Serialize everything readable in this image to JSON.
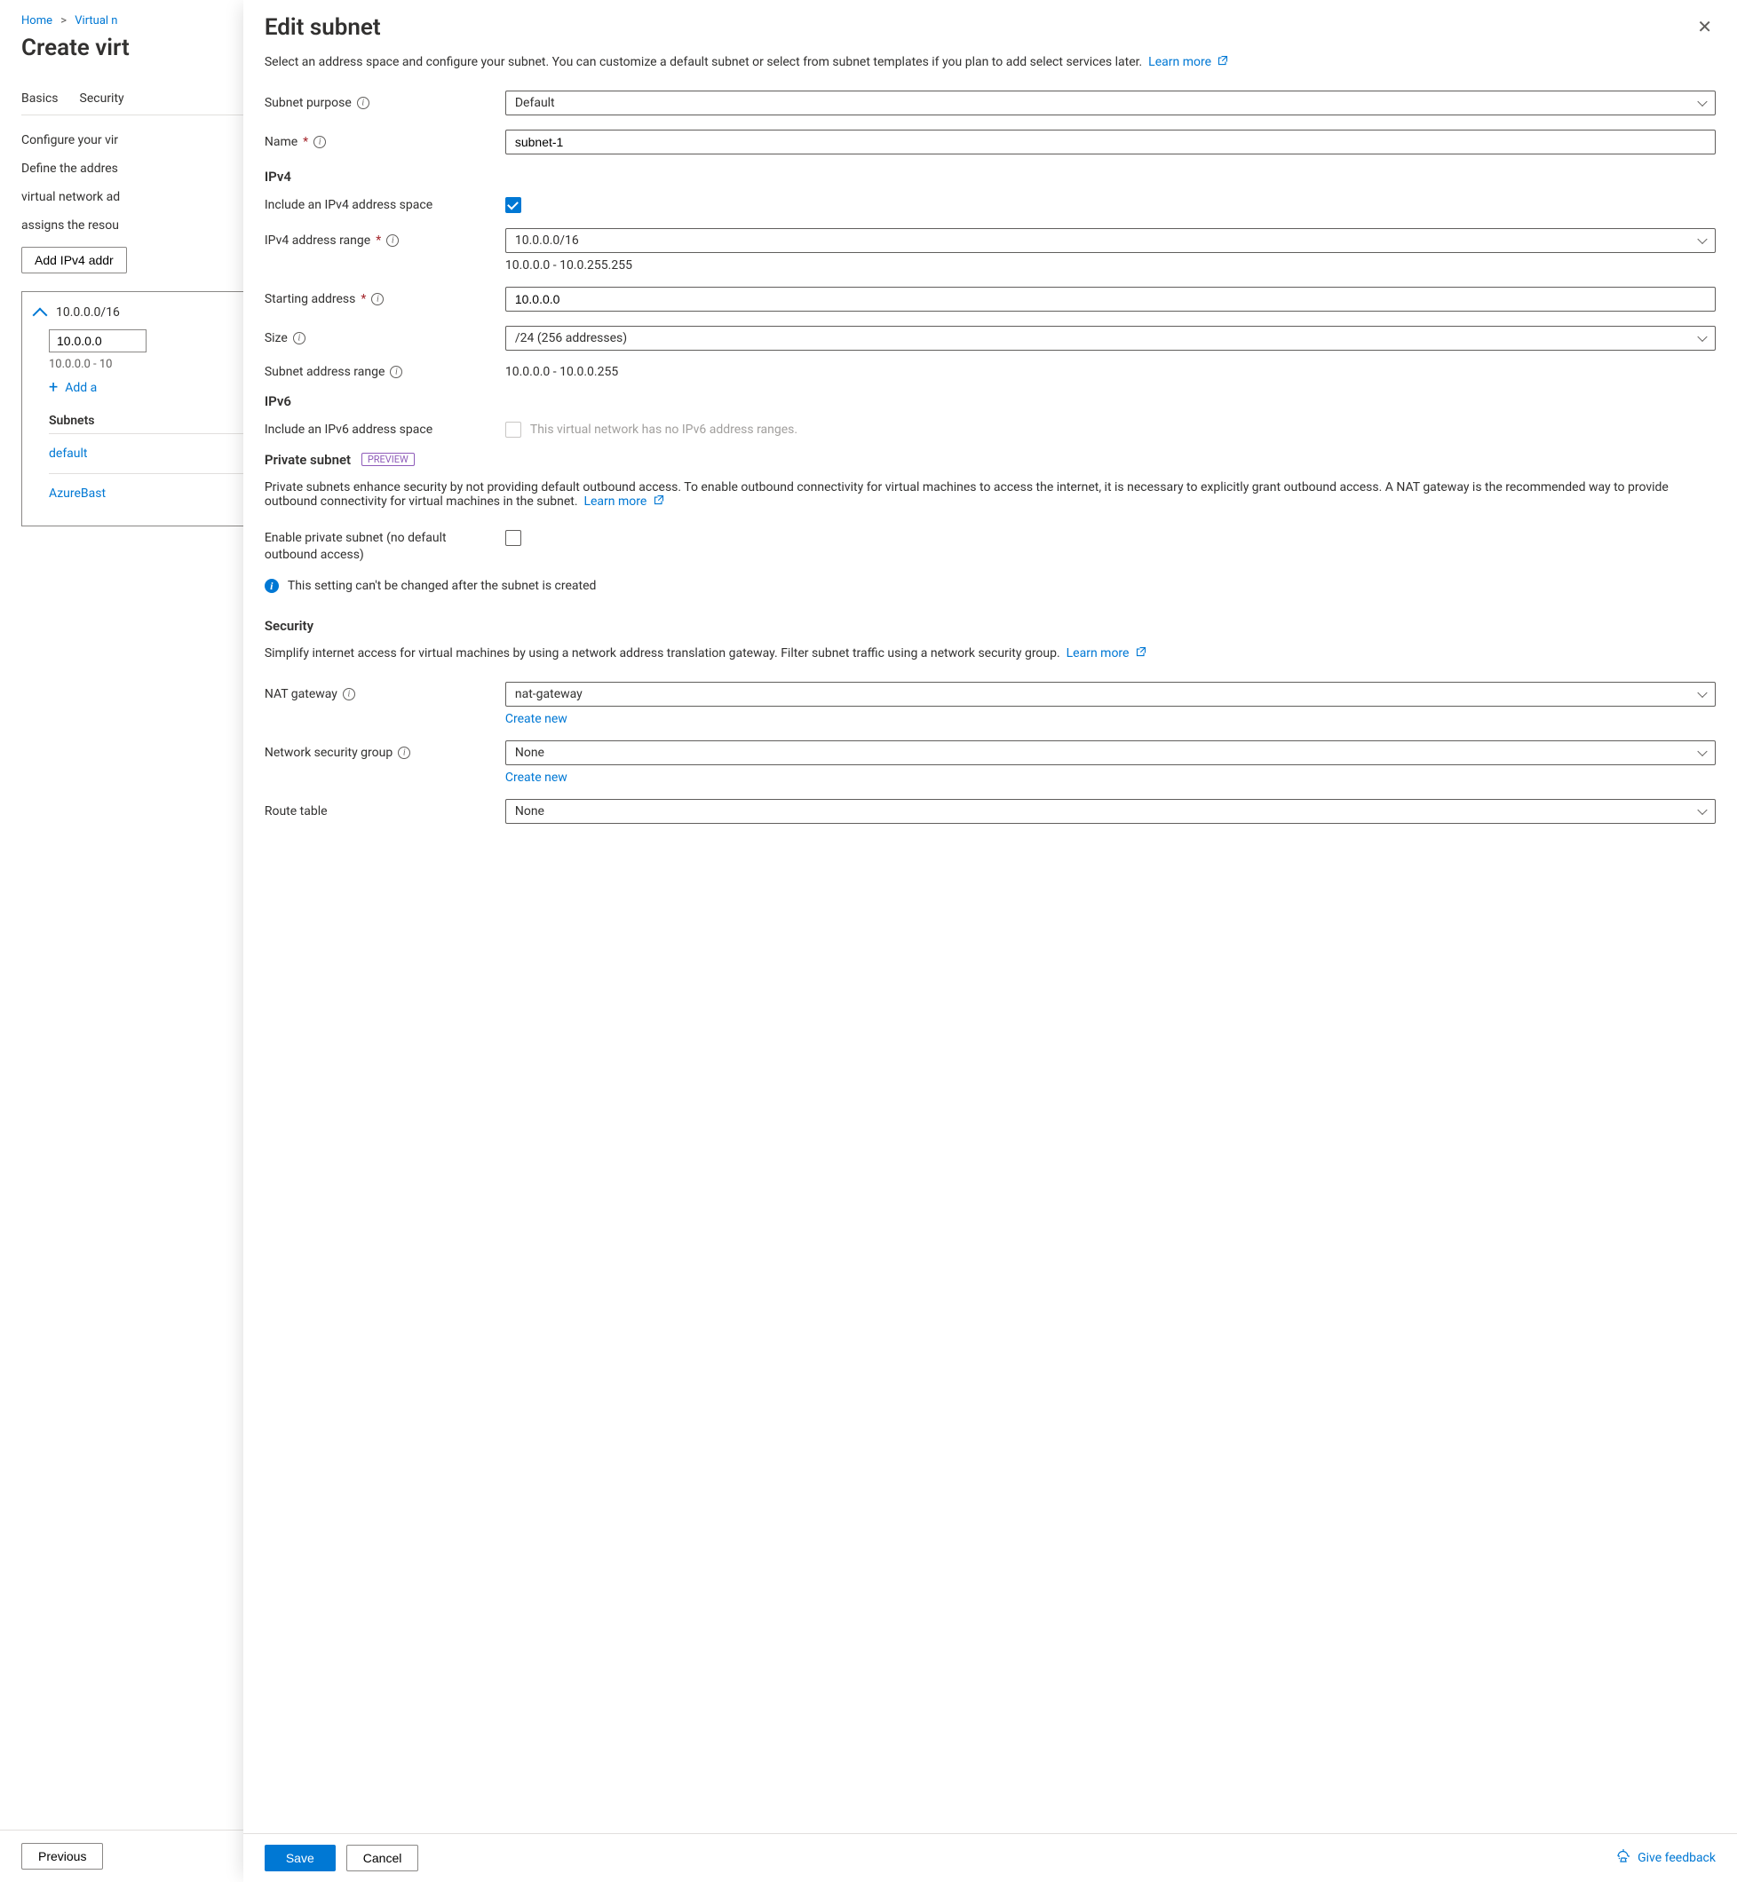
{
  "breadcrumb": {
    "home": "Home",
    "second": "Virtual n"
  },
  "page": {
    "title": "Create virt",
    "tabs": [
      "Basics",
      "Security"
    ],
    "intro": "Configure your vir",
    "desc2a": "Define the addres",
    "desc2b": "virtual network ad",
    "desc2c": "assigns the resou",
    "add_space_btn": "Add IPv4 addr",
    "space": {
      "cidr": "10.0.0.0/16",
      "start_value": "10.0.0.0",
      "range_hint": "10.0.0.0 - 10",
      "add_subnet": "Add a",
      "col_header": "Subnets",
      "items": [
        "default",
        "AzureBast"
      ]
    },
    "previous_btn": "Previous"
  },
  "blade": {
    "title": "Edit subnet",
    "desc": "Select an address space and configure your subnet. You can customize a default subnet or select from subnet templates if you plan to add select services later.",
    "learn_more": "Learn more",
    "fields": {
      "subnet_purpose": {
        "label": "Subnet purpose",
        "value": "Default"
      },
      "name": {
        "label": "Name",
        "value": "subnet-1"
      },
      "ipv4_title": "IPv4",
      "include_ipv4": {
        "label": "Include an IPv4 address space",
        "checked": true
      },
      "ipv4_range": {
        "label": "IPv4 address range",
        "value": "10.0.0.0/16",
        "hint": "10.0.0.0 - 10.0.255.255"
      },
      "starting_address": {
        "label": "Starting address",
        "value": "10.0.0.0"
      },
      "size": {
        "label": "Size",
        "value": "/24 (256 addresses)"
      },
      "subnet_range": {
        "label": "Subnet address range",
        "value": "10.0.0.0 - 10.0.0.255"
      },
      "ipv6_title": "IPv6",
      "include_ipv6": {
        "label": "Include an IPv6 address space",
        "hint": "This virtual network has no IPv6 address ranges."
      },
      "private_title": "Private subnet",
      "preview_badge": "PREVIEW",
      "private_desc": "Private subnets enhance security by not providing default outbound access. To enable outbound connectivity for virtual machines to access the internet, it is necessary to explicitly grant outbound access. A NAT gateway is the recommended way to provide outbound connectivity for virtual machines in the subnet.",
      "enable_private": {
        "label": "Enable private subnet (no default outbound access)"
      },
      "private_info": "This setting can't be changed after the subnet is created",
      "security_title": "Security",
      "security_desc": "Simplify internet access for virtual machines by using a network address translation gateway. Filter subnet traffic using a network security group.",
      "nat_gateway": {
        "label": "NAT gateway",
        "value": "nat-gateway",
        "create_new": "Create new"
      },
      "nsg": {
        "label": "Network security group",
        "value": "None",
        "create_new": "Create new"
      },
      "route_table": {
        "label": "Route table",
        "value": "None"
      }
    },
    "footer": {
      "save": "Save",
      "cancel": "Cancel",
      "feedback": "Give feedback"
    }
  }
}
